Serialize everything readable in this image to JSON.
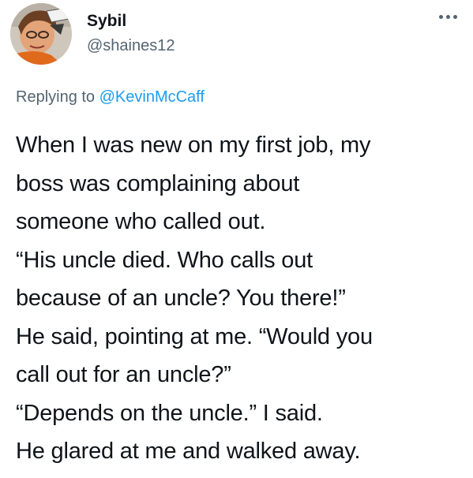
{
  "tweet": {
    "author": {
      "display_name": "Sybil",
      "handle": "@shaines12",
      "avatar_icon": "user-avatar-photo"
    },
    "more_icon": "more-options-icon",
    "reply": {
      "prefix": "Replying to",
      "mention": "@KevinMcCaff"
    },
    "lines": [
      "When I was new on my first job, my",
      "boss was complaining about",
      "someone who called out.",
      "“His uncle died. Who calls out",
      "because of an uncle? You there!”",
      "He said, pointing at me. “Would you",
      "call out for an uncle?”",
      "“Depends on the uncle.” I said.",
      "He glared at me and walked away."
    ]
  },
  "colors": {
    "text_primary": "#0f1419",
    "text_secondary": "#536471",
    "link": "#1d9bf0",
    "background": "#ffffff"
  }
}
